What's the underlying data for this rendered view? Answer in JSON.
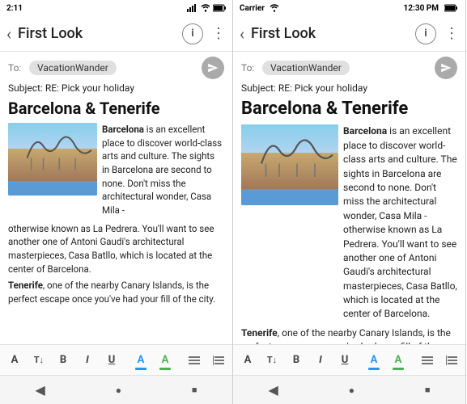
{
  "left_panel": {
    "status_bar": {
      "time": "2:11",
      "icons": "signal wifi battery"
    },
    "app_bar": {
      "back_icon": "‹",
      "title": "First Look",
      "info_icon": "i",
      "more_icon": "⋮"
    },
    "to_label": "To:",
    "to_value": "VacationWander",
    "subject_label": "Subject:",
    "subject_value": "RE: Pick your holiday",
    "email_title": "Barcelona & Tenerife",
    "body_inline": "Barcelona is an excellent place to discover world-class arts and culture. The sights in Barcelona are second to none. Don't miss the architectural wonder, Casa Mila -",
    "body_cont": "otherwise known as La Pedrera. You'll want to see another one of Antoni Gaudi's architectural masterpieces, Casa Batllo, which is located at the center of Barcelona.",
    "body_tenerife": "Tenerife, one of the nearby Canary Islands, is the perfect escape once you've had your fill of the city.",
    "toolbar": {
      "a_label": "A",
      "t_label": "T↓",
      "b_label": "B",
      "i_label": "I",
      "u_label": "U",
      "a_color_label": "A",
      "a_highlight_label": "A",
      "list1_label": "≡",
      "list2_label": "≡"
    },
    "nav": {
      "back": "◀",
      "home": "●",
      "recent": "■"
    }
  },
  "right_panel": {
    "status_bar": {
      "carrier": "Carrier",
      "time": "12:30 PM",
      "battery": "battery"
    },
    "app_bar": {
      "back_icon": "‹",
      "title": "First Look",
      "info_icon": "i",
      "more_icon": "⋮"
    },
    "to_label": "To:",
    "to_value": "VacationWander",
    "subject_label": "Subject:",
    "subject_value": "RE: Pick your holiday",
    "email_title": "Barcelona & Tenerife",
    "body_inline": "Barcelona is an excellent place to discover world-class arts and culture. The sights in Barcelona are second to none. Don't miss the architectural wonder, Casa Mila - otherwise known as La Pedrera. You'll want to see another one of Antoni Gaudi's architectural masterpieces, Casa Batllo, which is located at the center of Barcelona.",
    "body_tenerife": "Tenerife, one of the nearby Canary Islands, is the perfect escape once you've had your fill of the",
    "toolbar": {
      "a_label": "A",
      "t_label": "T↓",
      "b_label": "B",
      "i_label": "I",
      "u_label": "U",
      "a_color_label": "A",
      "a_highlight_label": "A",
      "list1_label": "≡",
      "list2_label": "≡"
    },
    "nav": {
      "back": "◀",
      "home": "●",
      "recent": "■"
    }
  }
}
